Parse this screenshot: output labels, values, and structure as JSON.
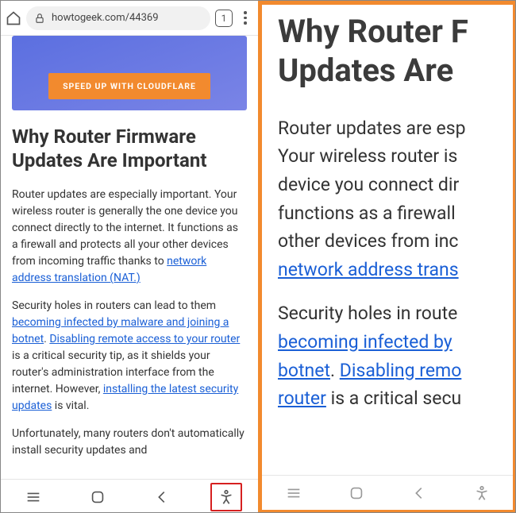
{
  "addressbar": {
    "url": "howtogeek.com/44369",
    "tab_count": "1"
  },
  "banner": {
    "button_label": "SPEED UP WITH CLOUDFLARE"
  },
  "article": {
    "heading": "Why Router Firmware Updates Are Important",
    "p1_a": "Router updates are especially important. Your wireless router is generally the one device you connect directly to the internet. It functions as a firewall and protects all your other devices from incoming traffic thanks to ",
    "p1_link": "network address translation (NAT.)",
    "p2_a": "Security holes in routers can lead to them ",
    "p2_link1": "becoming infected by malware and joining a botnet",
    "p2_b": ". ",
    "p2_link2": "Disabling remote access to your router",
    "p2_c": " is a critical security tip, as it shields your router's administration interface from the internet. However, ",
    "p2_link3": "installing the latest security updates",
    "p2_d": " is vital.",
    "p3": "Unfortunately, many routers don't automatically install security updates and"
  },
  "zoom": {
    "heading_l1": "Why Router F",
    "heading_l2": "Updates Are ",
    "p1_l1": "Router updates are esp",
    "p1_l2": "Your wireless router is",
    "p1_l3": "device you connect dir",
    "p1_l4": "functions as a firewall ",
    "p1_l5": "other devices from inc",
    "p1_link": "network address trans",
    "p2_l1": "Security holes in route",
    "p2_link1": "becoming infected by ",
    "p2_link2a": "botnet",
    "p2_mid": ". ",
    "p2_link2b": "Disabling remo",
    "p2_link3": "router",
    "p2_l4": " is a critical secu"
  }
}
